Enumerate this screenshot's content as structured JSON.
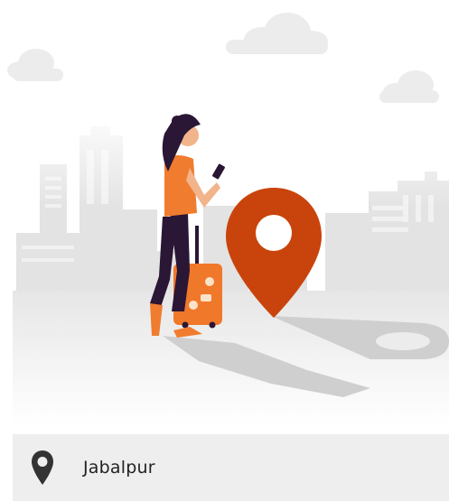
{
  "location": {
    "label": "Jabalpur",
    "icon": "map-pin-icon"
  },
  "illustration": {
    "subject": "traveler-with-suitcase-and-location-pin",
    "colors": {
      "pin": "#c9440c",
      "shirt": "#f07c2f",
      "suitcase": "#f0782a",
      "pants": "#2a1635",
      "city": "#e3e3e3",
      "ground": "#e9e9e9"
    }
  }
}
